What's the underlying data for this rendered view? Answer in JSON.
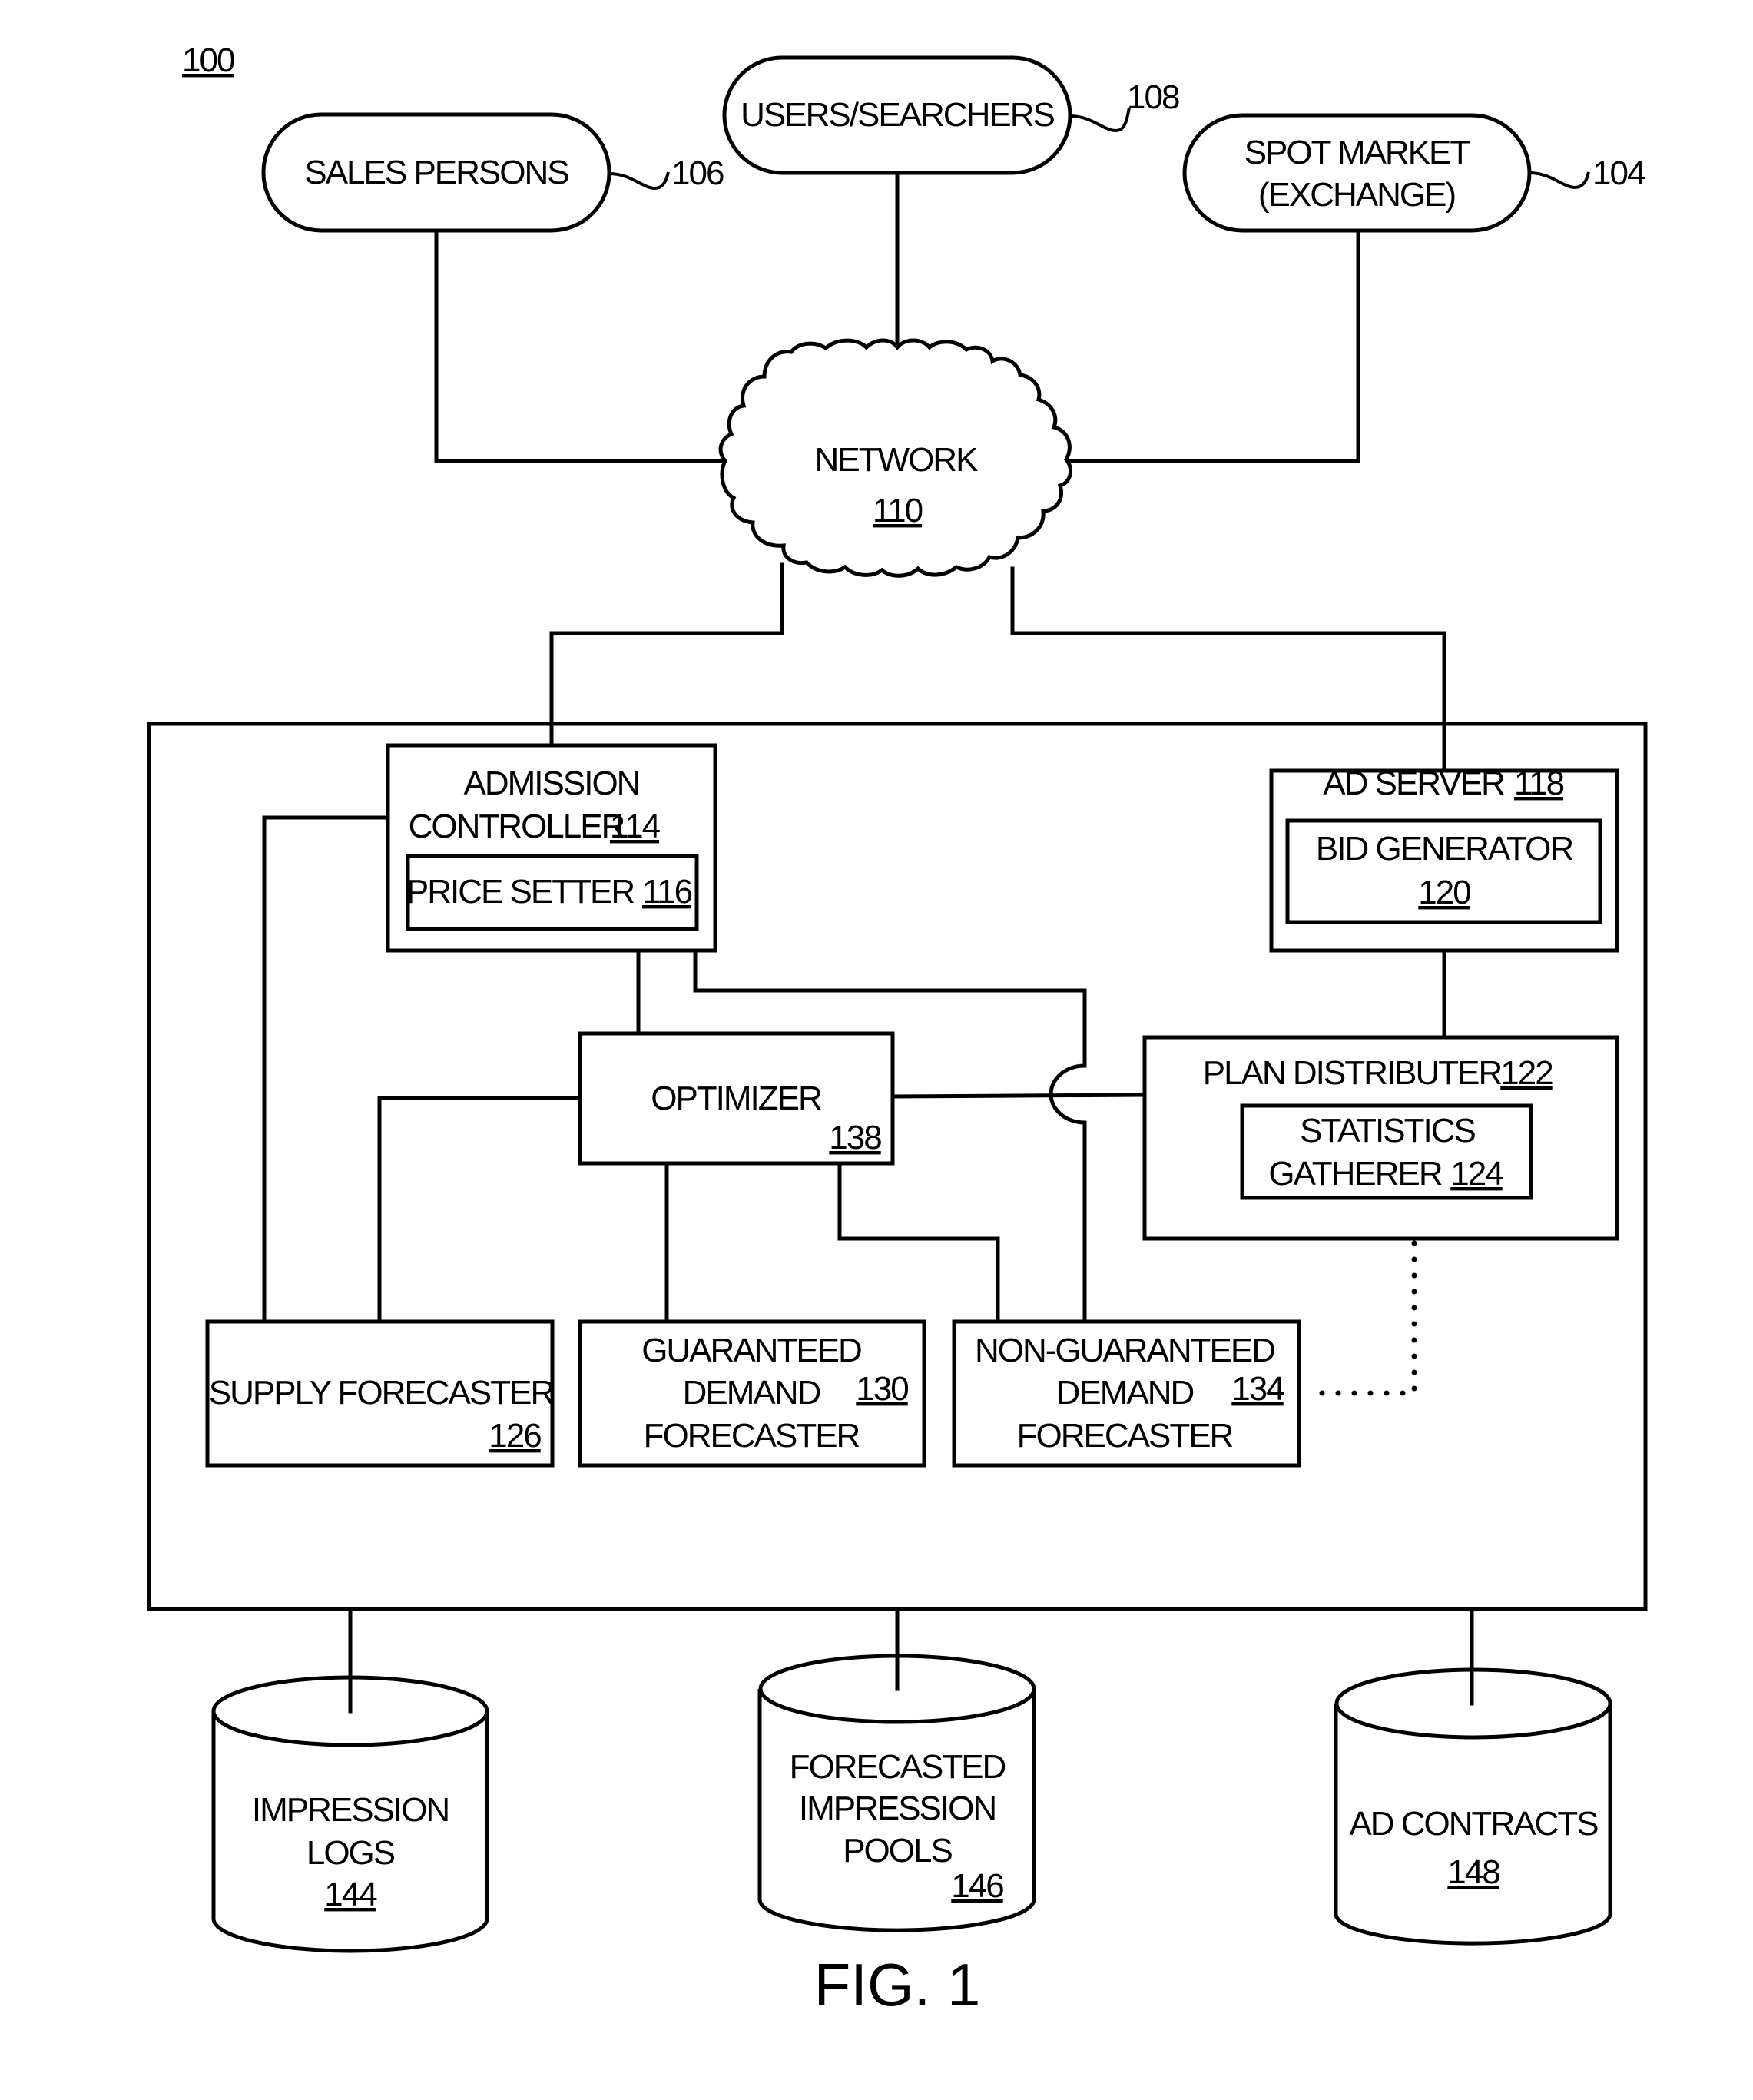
{
  "figure": {
    "system_ref": "100",
    "caption": "FIG. 1"
  },
  "actors": {
    "sales_persons": {
      "label": "SALES PERSONS",
      "ref": "106"
    },
    "users_searchers": {
      "label": "USERS/SEARCHERS",
      "ref": "108"
    },
    "spot_market": {
      "line1": "SPOT MARKET",
      "line2": "(EXCHANGE)",
      "ref": "104"
    }
  },
  "network": {
    "label": "NETWORK",
    "ref": "110"
  },
  "components": {
    "admission_controller": {
      "line1": "ADMISSION",
      "line2": "CONTROLLER",
      "ref": "114"
    },
    "price_setter": {
      "label": "PRICE SETTER",
      "ref": "116"
    },
    "ad_server": {
      "label": "AD SERVER",
      "ref": "118"
    },
    "bid_generator": {
      "label": "BID GENERATOR",
      "ref": "120"
    },
    "optimizer": {
      "label": "OPTIMIZER",
      "ref": "138"
    },
    "plan_distributer": {
      "label": "PLAN DISTRIBUTER",
      "ref": "122"
    },
    "statistics_gatherer": {
      "line1": "STATISTICS",
      "line2": "GATHERER",
      "ref": "124"
    },
    "supply_forecaster": {
      "label": "SUPPLY FORECASTER",
      "ref": "126"
    },
    "guaranteed_demand_forecaster": {
      "line1": "GUARANTEED",
      "line2": "DEMAND",
      "line3": "FORECASTER",
      "ref": "130"
    },
    "non_guaranteed_demand_forecaster": {
      "line1": "NON-GUARANTEED",
      "line2": "DEMAND",
      "line3": "FORECASTER",
      "ref": "134"
    }
  },
  "datastores": {
    "impression_logs": {
      "line1": "IMPRESSION",
      "line2": "LOGS",
      "ref": "144"
    },
    "forecasted_impression_pools": {
      "line1": "FORECASTED",
      "line2": "IMPRESSION",
      "line3": "POOLS",
      "ref": "146"
    },
    "ad_contracts": {
      "label": "AD CONTRACTS",
      "ref": "148"
    }
  }
}
